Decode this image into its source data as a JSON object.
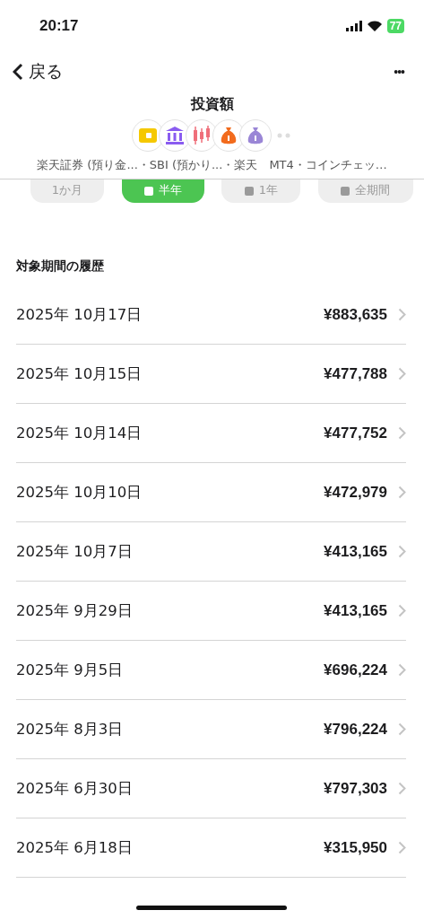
{
  "status_bar": {
    "time": "20:17",
    "battery": "77"
  },
  "nav": {
    "back": "戻る",
    "more": "•••"
  },
  "header": {
    "title": "投資額",
    "accounts": [
      {
        "kind": "wallet",
        "color": "#f5c800"
      },
      {
        "kind": "bank",
        "color": "#8a5cf0"
      },
      {
        "kind": "candles",
        "color": "#ef6f7a"
      },
      {
        "kind": "bag",
        "color": "#f26b1d"
      },
      {
        "kind": "bag",
        "color": "#9a86d6"
      }
    ],
    "subtitle": "楽天証券 (預り金...・SBI (預かり...・楽天　MT4・コインチェッ…"
  },
  "tabs": [
    {
      "label": "1か月",
      "selected": false,
      "locked": false
    },
    {
      "label": "半年",
      "selected": true,
      "locked": true
    },
    {
      "label": "1年",
      "selected": false,
      "locked": true
    },
    {
      "label": "全期間",
      "selected": false,
      "locked": true
    }
  ],
  "section_title": "対象期間の履歴",
  "history": [
    {
      "date": "2025年 10月17日",
      "amount": "¥883,635"
    },
    {
      "date": "2025年 10月15日",
      "amount": "¥477,788"
    },
    {
      "date": "2025年 10月14日",
      "amount": "¥477,752"
    },
    {
      "date": "2025年 10月10日",
      "amount": "¥472,979"
    },
    {
      "date": "2025年 10月7日",
      "amount": "¥413,165"
    },
    {
      "date": "2025年 9月29日",
      "amount": "¥413,165"
    },
    {
      "date": "2025年 9月5日",
      "amount": "¥696,224"
    },
    {
      "date": "2025年 8月3日",
      "amount": "¥796,224"
    },
    {
      "date": "2025年 6月30日",
      "amount": "¥797,303"
    },
    {
      "date": "2025年 6月18日",
      "amount": "¥315,950"
    }
  ]
}
